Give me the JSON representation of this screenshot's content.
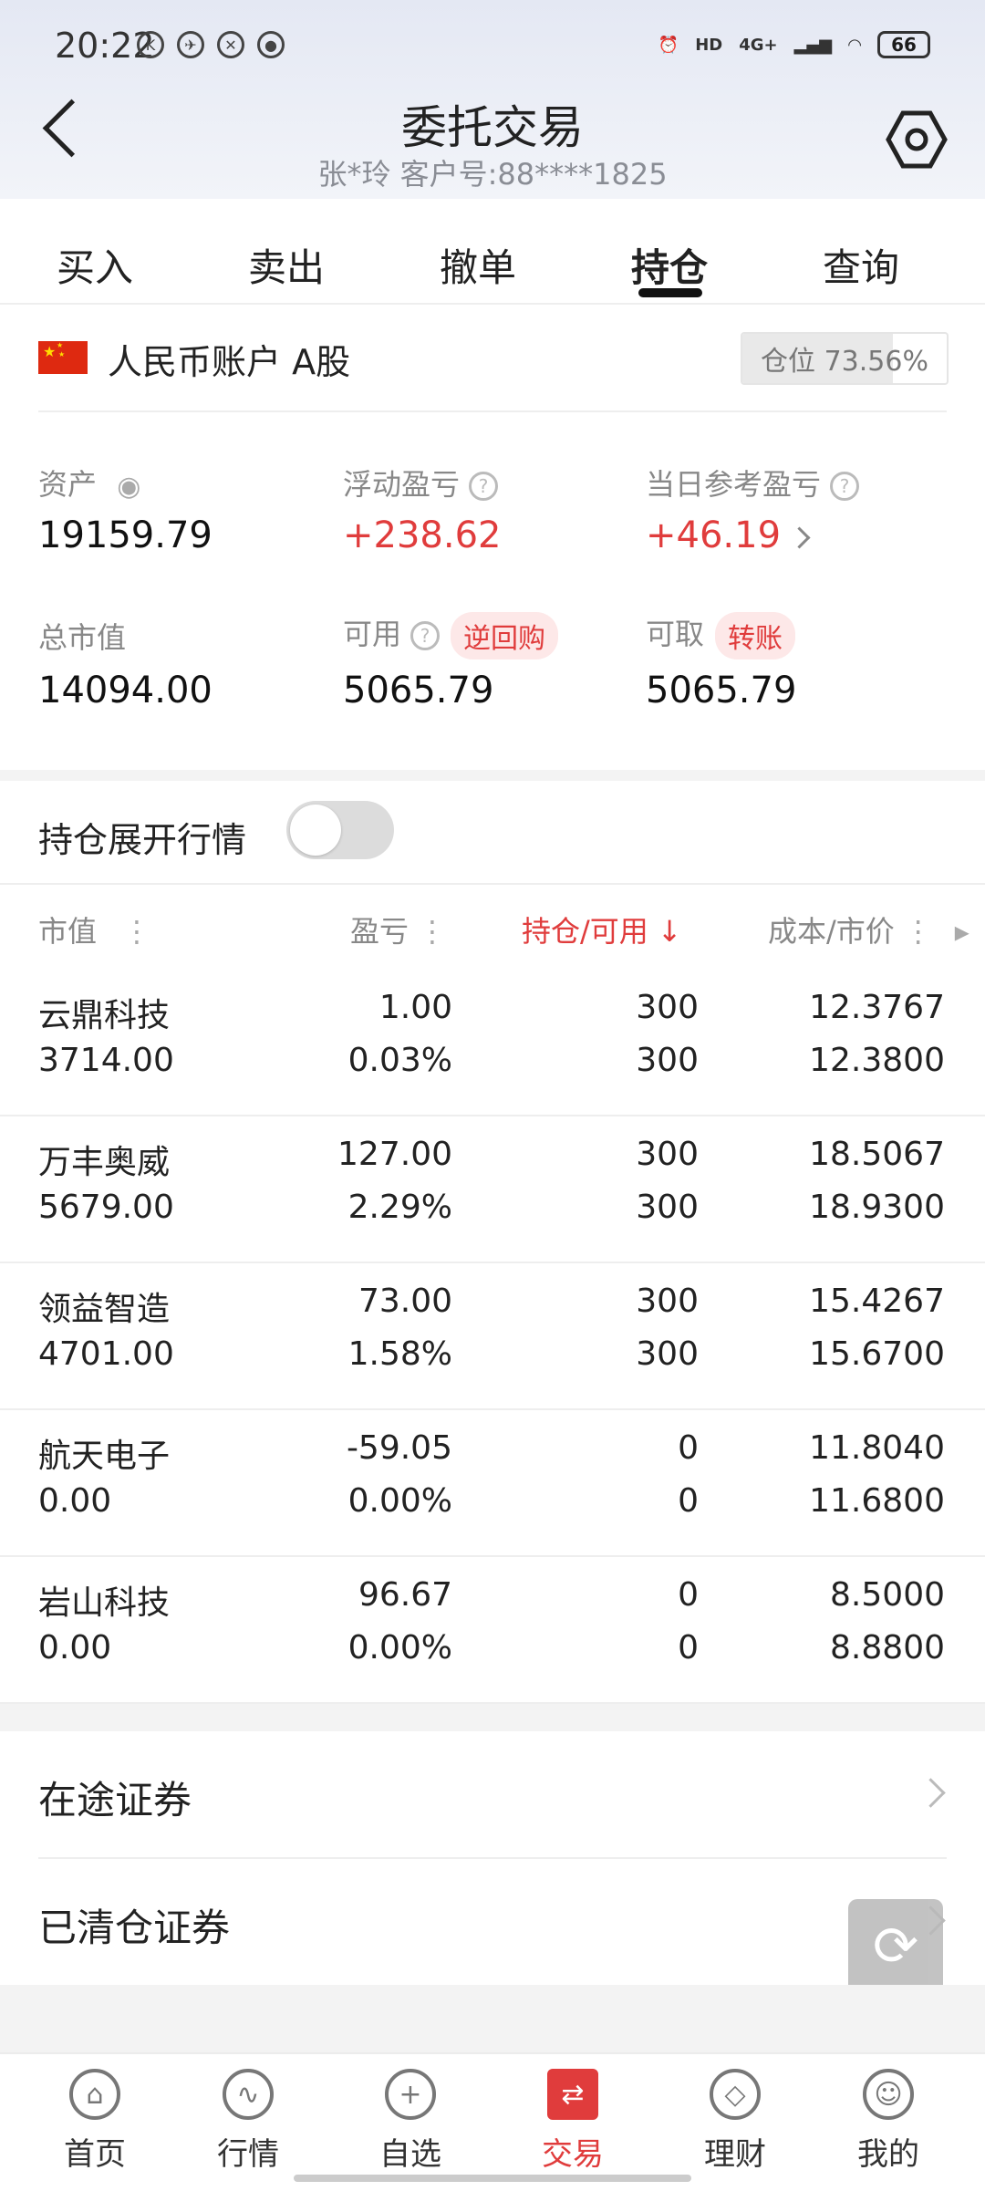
{
  "status_bar": {
    "time": "20:22",
    "network": "4G+",
    "battery": "66"
  },
  "header": {
    "title": "委托交易",
    "subtitle": "张*玲  客户号:88****1825"
  },
  "tabs": [
    "买入",
    "卖出",
    "撤单",
    "持仓",
    "查询"
  ],
  "active_tab": "持仓",
  "account": {
    "label": "人民币账户 A股",
    "position_ratio_text": "仓位 73.56%",
    "position_ratio": 0.7356
  },
  "summary": {
    "assets_label": "资产",
    "assets_value": "19159.79",
    "float_pl_label": "浮动盈亏",
    "float_pl_value": "+238.62",
    "daily_pl_label": "当日参考盈亏",
    "daily_pl_value": "+46.19",
    "market_value_label": "总市值",
    "market_value": "14094.00",
    "available_label": "可用",
    "available_value": "5065.79",
    "reverse_repo_label": "逆回购",
    "withdrawable_label": "可取",
    "withdrawable_value": "5065.79",
    "transfer_label": "转账"
  },
  "toggle": {
    "label": "持仓展开行情",
    "on": false
  },
  "table_header": {
    "col1": "市值",
    "col2": "盈亏",
    "col3": "持仓/可用",
    "col4": "成本/市价"
  },
  "holdings": [
    {
      "name": "云鼎科技",
      "market_value": "3714.00",
      "pl": "1.00",
      "pl_pct": "0.03%",
      "position": "300",
      "available": "300",
      "cost": "12.3767",
      "price": "12.3800"
    },
    {
      "name": "万丰奥威",
      "market_value": "5679.00",
      "pl": "127.00",
      "pl_pct": "2.29%",
      "position": "300",
      "available": "300",
      "cost": "18.5067",
      "price": "18.9300"
    },
    {
      "name": "领益智造",
      "market_value": "4701.00",
      "pl": "73.00",
      "pl_pct": "1.58%",
      "position": "300",
      "available": "300",
      "cost": "15.4267",
      "price": "15.6700"
    },
    {
      "name": "航天电子",
      "market_value": "0.00",
      "pl": "-59.05",
      "pl_pct": "0.00%",
      "position": "0",
      "available": "0",
      "cost": "11.8040",
      "price": "11.6800"
    },
    {
      "name": "岩山科技",
      "market_value": "0.00",
      "pl": "96.67",
      "pl_pct": "0.00%",
      "position": "0",
      "available": "0",
      "cost": "8.5000",
      "price": "8.8800"
    }
  ],
  "links": {
    "in_transit": "在途证券",
    "cleared": "已清仓证券"
  },
  "bottom_nav": [
    "首页",
    "行情",
    "自选",
    "交易",
    "理财",
    "我的"
  ],
  "colors": {
    "up": "#e03c3c",
    "down": "#16a085",
    "accent": "#e03c3c"
  }
}
